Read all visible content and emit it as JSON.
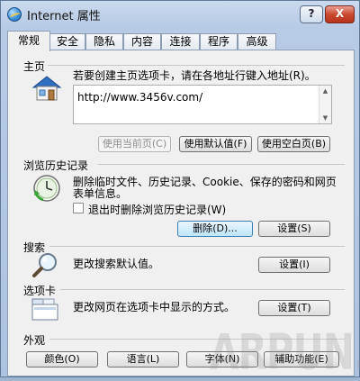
{
  "window": {
    "title": "Internet 属性",
    "help_label": "?",
    "close_label": "X",
    "icon": "internet-explorer-icon"
  },
  "tabs": [
    {
      "label": "常规",
      "active": true
    },
    {
      "label": "安全",
      "active": false
    },
    {
      "label": "隐私",
      "active": false
    },
    {
      "label": "内容",
      "active": false
    },
    {
      "label": "连接",
      "active": false
    },
    {
      "label": "程序",
      "active": false
    },
    {
      "label": "高级",
      "active": false
    }
  ],
  "home": {
    "title": "主页",
    "icon": "house-icon",
    "description": "若要创建主页选项卡，请在各地址行键入地址(R)。",
    "url": "http://www.3456v.com/",
    "buttons": {
      "use_current": "使用当前页(C)",
      "use_default": "使用默认值(F)",
      "use_blank": "使用空白页(B)"
    }
  },
  "history": {
    "title": "浏览历史记录",
    "icon": "clock-icon",
    "description_line1": "删除临时文件、历史记录、Cookie、保存的密码和网页",
    "description_line2": "表单信息。",
    "checkbox_label": "退出时删除浏览历史记录(W)",
    "checkbox_checked": false,
    "buttons": {
      "delete": "删除(D)...",
      "settings": "设置(S)"
    }
  },
  "search": {
    "title": "搜索",
    "icon": "magnifier-icon",
    "description": "更改搜索默认值。",
    "buttons": {
      "settings": "设置(I)"
    }
  },
  "tabs_section": {
    "title": "选项卡",
    "icon": "tabs-window-icon",
    "description": "更改网页在选项卡中显示的方式。",
    "buttons": {
      "settings": "设置(T)"
    }
  },
  "appearance": {
    "title": "外观",
    "buttons": {
      "colors": "颜色(O)",
      "languages": "语言(L)",
      "fonts": "字体(N)",
      "accessibility": "辅助功能(E)"
    }
  },
  "watermark": "ARPUN.COM",
  "colors": {
    "title_gradient_top": "#c9d9ee",
    "panel": "#f0f0f0",
    "close_red": "#c9482f"
  }
}
